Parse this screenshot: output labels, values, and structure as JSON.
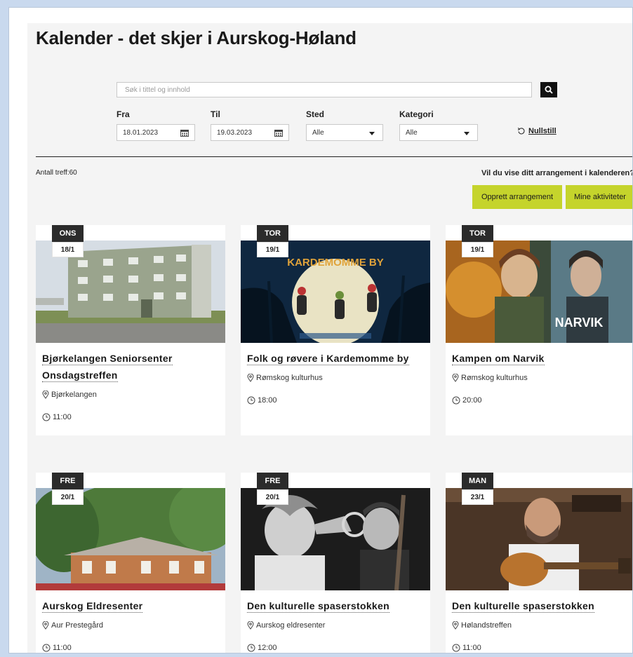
{
  "page": {
    "title": "Kalender - det skjer i Aurskog-Høland"
  },
  "search": {
    "placeholder": "Søk i tittel og innhold"
  },
  "filters": {
    "from": {
      "label": "Fra",
      "value": "18.01.2023"
    },
    "to": {
      "label": "Til",
      "value": "19.03.2023"
    },
    "place": {
      "label": "Sted",
      "value": "Alle"
    },
    "category": {
      "label": "Kategori",
      "value": "Alle"
    },
    "reset_label": "Nullstill"
  },
  "results": {
    "count_text": "Antall treff:60"
  },
  "promo": {
    "text": "Vil du vise ditt arrangement i kalenderen?"
  },
  "actions": {
    "create_label": "Opprett arrangement",
    "mine_label": "Mine aktiviteter"
  },
  "events": [
    {
      "day": "ONS",
      "date": "18/1",
      "title_lines": [
        "Bjørkelangen Seniorsenter",
        "Onsdagstreffen"
      ],
      "location": "Bjørkelangen",
      "time": "11:00"
    },
    {
      "day": "TOR",
      "date": "19/1",
      "title_lines": [
        "Folk og røvere i Kardemomme by"
      ],
      "location": "Rømskog kulturhus",
      "time": "18:00",
      "poster_text": "KARDEMOMME BY"
    },
    {
      "day": "TOR",
      "date": "19/1",
      "title_lines": [
        "Kampen om Narvik"
      ],
      "location": "Rømskog kulturhus",
      "time": "20:00",
      "poster_text": "NARVIK"
    },
    {
      "day": "FRE",
      "date": "20/1",
      "title_lines": [
        "Aurskog Eldresenter"
      ],
      "location": "Aur Prestegård",
      "time": "11:00"
    },
    {
      "day": "FRE",
      "date": "20/1",
      "title_lines": [
        "Den kulturelle spaserstokken"
      ],
      "location": "Aurskog eldresenter",
      "time": "12:00"
    },
    {
      "day": "MAN",
      "date": "23/1",
      "title_lines": [
        "Den kulturelle spaserstokken"
      ],
      "location": "Hølandstreffen",
      "time": "11:00"
    }
  ],
  "colors": {
    "accent": "#c5d42c",
    "badge": "#2b2b2b"
  }
}
